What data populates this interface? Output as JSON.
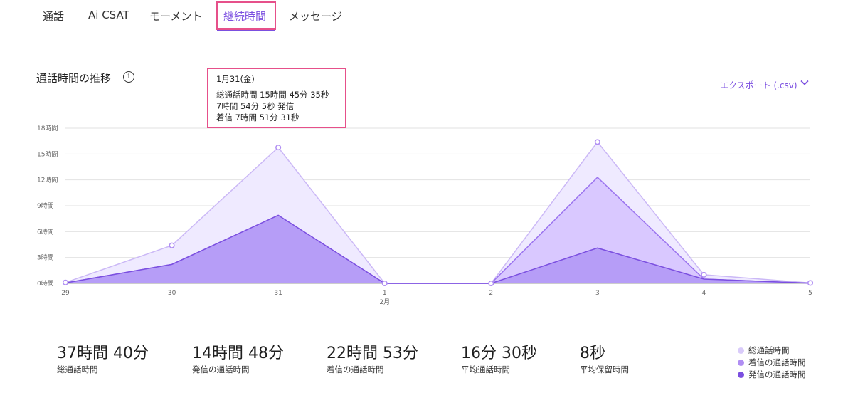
{
  "tabs": [
    {
      "label": "通話"
    },
    {
      "label": "Ai CSAT"
    },
    {
      "label": "モーメント"
    },
    {
      "label": "継続時間",
      "active": true
    },
    {
      "label": "メッセージ"
    }
  ],
  "section_title": "通話時間の推移",
  "info_icon_label": "i",
  "export_label": "エクスポート (.csv)",
  "tooltip": {
    "date": "1月31(金)",
    "lines": [
      "総通話時間 15時間 45分 35秒",
      "7時間 54分 5秒 発信",
      "着信 7時間 51分 31秒"
    ]
  },
  "colors": {
    "accent": "#7b4fe0",
    "highlight_box": "#e6508a",
    "total_fill": "#efeaff",
    "total_line": "#cbb8f6",
    "incoming_fill": "#d9c8ff",
    "incoming_line": "#9b74ef",
    "outgoing_fill": "#b69df7",
    "outgoing_line": "#7b4fe0"
  },
  "chart_data": {
    "type": "area",
    "x": [
      "29",
      "30",
      "31",
      "1",
      "2",
      "3",
      "4",
      "5"
    ],
    "x_sublabels": {
      "1": "2月"
    },
    "yticks": [
      "0時間",
      "3時間",
      "6時間",
      "9時間",
      "12時間",
      "15時間",
      "18時間"
    ],
    "ylim": [
      0,
      18
    ],
    "grid": true,
    "series": [
      {
        "name": "総通話時間",
        "values": [
          0.1,
          4.4,
          15.76,
          0,
          0,
          16.4,
          1.0,
          0.05
        ],
        "fill": "#efeaff",
        "line": "#cbb8f6"
      },
      {
        "name": "着信の通話時間",
        "values": [
          0.05,
          2.2,
          7.86,
          0,
          0,
          12.3,
          0.5,
          0.02
        ],
        "fill": "#d9c8ff",
        "line": "#9b74ef"
      },
      {
        "name": "発信の通話時間",
        "values": [
          0.05,
          2.2,
          7.9,
          0,
          0,
          4.1,
          0.5,
          0.02
        ],
        "fill": "#b69df7",
        "line": "#7b4fe0"
      }
    ]
  },
  "stats": [
    {
      "value": "37時間 40分",
      "label": "総通話時間"
    },
    {
      "value": "14時間 48分",
      "label": "発信の通話時間"
    },
    {
      "value": "22時間 53分",
      "label": "着信の通話時間"
    },
    {
      "value": "16分 30秒",
      "label": "平均通話時間"
    },
    {
      "value": "8秒",
      "label": "平均保留時間"
    }
  ],
  "legend": [
    {
      "label": "総通話時間",
      "color": "#d9cbfa"
    },
    {
      "label": "着信の通話時間",
      "color": "#b08ef3"
    },
    {
      "label": "発信の通話時間",
      "color": "#7b4fe0"
    }
  ]
}
